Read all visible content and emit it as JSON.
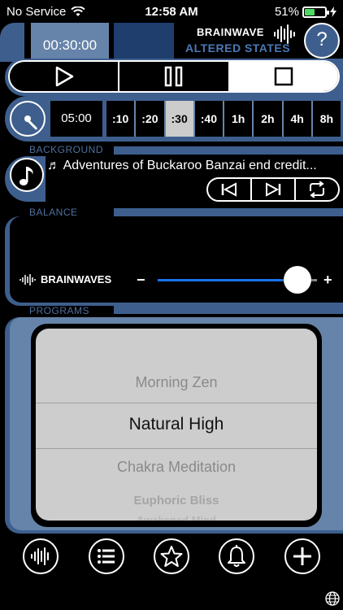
{
  "status": {
    "carrier": "No Service",
    "time": "12:58 AM",
    "battery": "51%",
    "battery_level": 0.51
  },
  "header": {
    "timer": "00:30:00",
    "brand_line1": "BRAINWAVE",
    "brand_line2": "ALTERED STATES",
    "help": "?"
  },
  "timer": {
    "duration": "05:00",
    "presets": [
      ":10",
      ":20",
      ":30",
      ":40",
      "1h",
      "2h",
      "4h",
      "8h"
    ],
    "selected": ":30"
  },
  "sections": {
    "background": "BACKGROUND",
    "balance": "BALANCE",
    "programs": "PROGRAMS"
  },
  "background": {
    "track": "♬ Adventures of Buckaroo Banzai end credit..."
  },
  "balance": {
    "label": "BRAINWAVES",
    "minus": "−",
    "plus": "+",
    "value": 0.88
  },
  "programs": {
    "items": [
      "Morning Zen",
      "Natural High",
      "Chakra Meditation",
      "Euphoric Bliss",
      "Awakened Mind"
    ],
    "selected": "Natural High"
  },
  "colors": {
    "frame": "#3e5f8e",
    "frame_light": "#6684a9",
    "accent_text": "#4a78b5",
    "slider": "#1a73e8"
  },
  "icons": [
    "wifi-icon",
    "play-icon",
    "pause-icon",
    "stop-icon",
    "timer-dial-icon",
    "music-note-icon",
    "skip-back-icon",
    "skip-forward-icon",
    "repeat-icon",
    "waveform-icon",
    "list-icon",
    "star-icon",
    "bell-icon",
    "plus-icon",
    "globe-icon"
  ]
}
